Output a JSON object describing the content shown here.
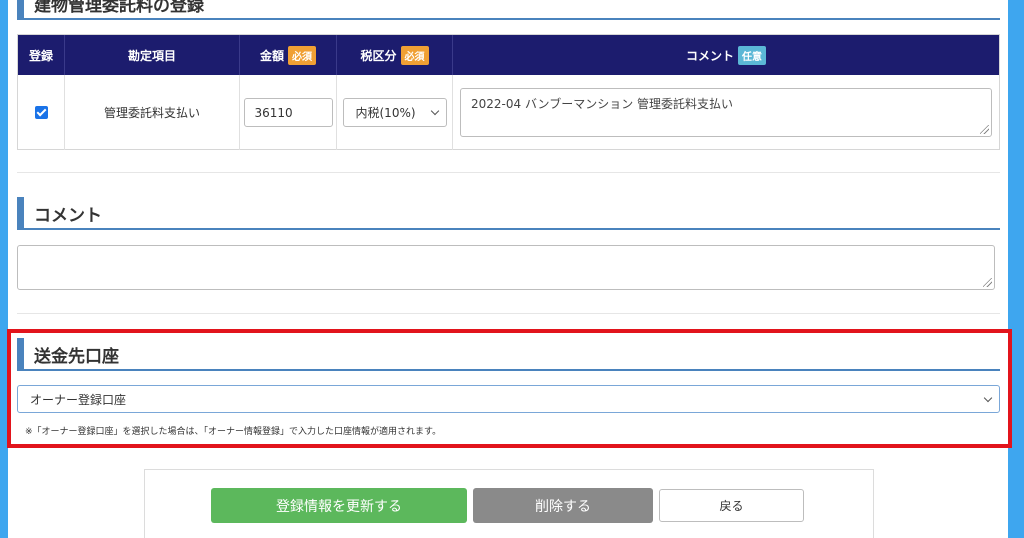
{
  "sections": {
    "fee": "建物管理委託料の登録",
    "comment": "コメント",
    "account": "送金先口座"
  },
  "table": {
    "headers": {
      "register": "登録",
      "item": "勘定項目",
      "amount": "金額",
      "tax": "税区分",
      "comment": "コメント"
    },
    "badges": {
      "required": "必須",
      "optional": "任意"
    },
    "row": {
      "checked": true,
      "item": "管理委託料支払い",
      "amount": "36110",
      "tax": "内税(10%)",
      "comment": "2022-04 バンブーマンション 管理委託料支払い"
    }
  },
  "comment_field": {
    "value": ""
  },
  "account": {
    "selected": "オーナー登録口座",
    "note": "※「オーナー登録口座」を選択した場合は、「オーナー情報登録」で入力した口座情報が適用されます。"
  },
  "buttons": {
    "update": "登録情報を更新する",
    "delete": "削除する",
    "back": "戻る"
  },
  "colors": {
    "background": "#3ea6ef",
    "header_bg": "#1c1c6e",
    "accent": "#4a83bd",
    "required_badge": "#f0a034",
    "optional_badge": "#5bb7d6",
    "update_button": "#5cb85c",
    "delete_button": "#8a8a8a",
    "highlight": "#e2141c"
  }
}
